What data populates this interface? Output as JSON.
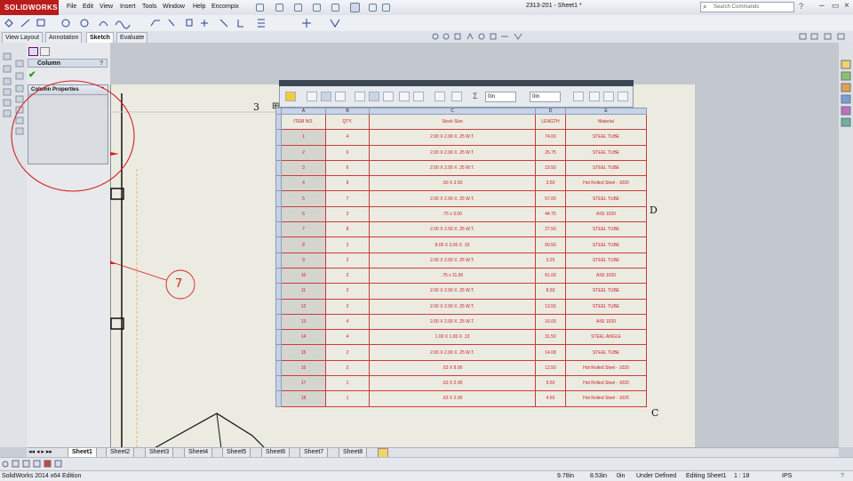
{
  "app": {
    "brand": "SOLIDWORKS",
    "doc_title": "2313-201 - Sheet1 *",
    "menu": [
      "File",
      "Edit",
      "View",
      "Insert",
      "Tools",
      "Window",
      "Help",
      "Encompix"
    ],
    "search_placeholder": "Search Commands",
    "accent_color": "#b81c1c"
  },
  "command_tabs": [
    {
      "label": "View Layout",
      "active": false
    },
    {
      "label": "Annotation",
      "active": false
    },
    {
      "label": "Sketch",
      "active": true
    },
    {
      "label": "Evaluate",
      "active": false
    }
  ],
  "property_manager": {
    "title": "Column",
    "section_title": "Column Properties"
  },
  "table_toolbar": {
    "field1": "0in",
    "field2": "0in"
  },
  "drawing": {
    "zone_3": "3",
    "zone_D": "D",
    "zone_C": "C",
    "balloon": "7",
    "annotation_color": "#d42020"
  },
  "bom": {
    "column_letters": [
      "A",
      "B",
      "C",
      "D",
      "E"
    ],
    "headers": [
      "ITEM NO.",
      "QTY.",
      "Stock Size",
      "LENGTH",
      "Material"
    ],
    "rows": [
      [
        "1",
        "4",
        "2.00 X 2.00 X .25 W.T.",
        "74.00",
        "STEEL TUBE"
      ],
      [
        "2",
        "6",
        "2.00 X 2.00 X .25 W.T.",
        "26.75",
        "STEEL TUBE"
      ],
      [
        "3",
        "6",
        "2.00 X 2.00 X .25 W.T.",
        "19.50",
        "STEEL TUBE"
      ],
      [
        "4",
        "8",
        ".50 X 3.50",
        "3.50",
        "Hot Rolled Steel - 1020"
      ],
      [
        "5",
        "7",
        "2.00 X 2.00 X .25 W.T.",
        "57.00",
        "STEEL TUBE"
      ],
      [
        "6",
        "2",
        ".75 x 3.00",
        "44.75",
        "AISI 1020"
      ],
      [
        "7",
        "8",
        "2.00 X 2.00 X .25 W.T.",
        "27.50",
        "STEEL TUBE"
      ],
      [
        "8",
        "2",
        "8.00 X 3.00 X .19",
        "60.50",
        "STEEL TUBE"
      ],
      [
        "9",
        "2",
        "2.00 X 2.00 X .25 W.T.",
        "3.25",
        "STEEL TUBE"
      ],
      [
        "10",
        "2",
        ".75 x 11.00",
        "61.00",
        "AISI 1020"
      ],
      [
        "11",
        "2",
        "2.00 X 2.00 X .25 W.T.",
        "8.50",
        "STEEL TUBE"
      ],
      [
        "12",
        "2",
        "2.00 X 2.00 X .25 W.T.",
        "13.55",
        "STEEL TUBE"
      ],
      [
        "13",
        "4",
        "2.00 X 2.00 X .25 W.T.",
        "16.00",
        "AISI 1020"
      ],
      [
        "14",
        "4",
        "1.00 X 1.00 X .13",
        "31.50",
        "STEEL ANGLE"
      ],
      [
        "15",
        "2",
        "2.00 X 2.00 X .25 W.T.",
        "14.08",
        "STEEL TUBE"
      ],
      [
        "16",
        "2",
        ".63 X 8.00",
        "12.50",
        "Hot Rolled Steel - 1020"
      ],
      [
        "17",
        "1",
        ".63 X 2.00",
        "9.50",
        "Hot Rolled Steel - 1020"
      ],
      [
        "18",
        "1",
        ".63 X 2.00",
        "4.50",
        "Hot Rolled Steel - 1020"
      ]
    ]
  },
  "sheet_tabs": [
    {
      "label": "Sheet1",
      "active": true
    },
    {
      "label": "Sheet2",
      "active": false
    },
    {
      "label": "Sheet3",
      "active": false
    },
    {
      "label": "Sheet4",
      "active": false
    },
    {
      "label": "Sheet5",
      "active": false
    },
    {
      "label": "Sheet6",
      "active": false
    },
    {
      "label": "Sheet7",
      "active": false
    },
    {
      "label": "Sheet8",
      "active": false
    }
  ],
  "status": {
    "product": "SolidWorks 2014 x64 Edition",
    "x": "9.78in",
    "y": "8.53in",
    "z": "0in",
    "state": "Under Defined",
    "editing": "Editing Sheet1",
    "scale": "1 : 18",
    "units": "IPS"
  }
}
